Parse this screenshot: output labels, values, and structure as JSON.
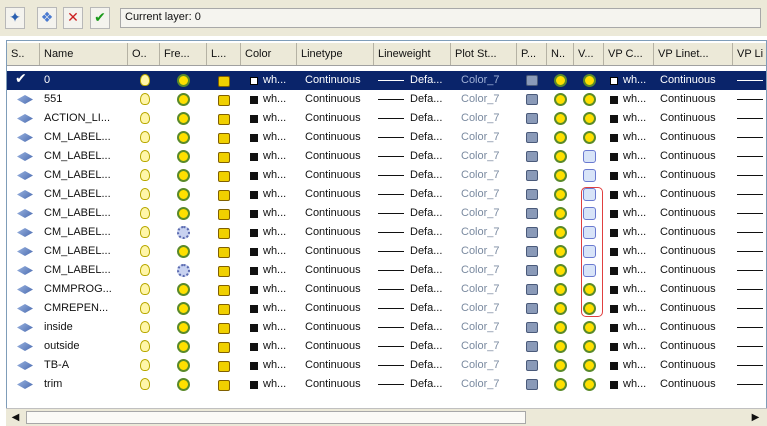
{
  "toolbar": {
    "current_layer_label": "Current layer: 0"
  },
  "headers": [
    {
      "id": "status",
      "label": "S.."
    },
    {
      "id": "name",
      "label": "Name"
    },
    {
      "id": "on",
      "label": "O.."
    },
    {
      "id": "freeze",
      "label": "Fre..."
    },
    {
      "id": "lock",
      "label": "L..."
    },
    {
      "id": "color",
      "label": "Color"
    },
    {
      "id": "linetype",
      "label": "Linetype"
    },
    {
      "id": "lineweight",
      "label": "Lineweight"
    },
    {
      "id": "plotstyle",
      "label": "Plot St..."
    },
    {
      "id": "plot",
      "label": "P..."
    },
    {
      "id": "newvp",
      "label": "N.."
    },
    {
      "id": "vpfreeze",
      "label": "V..."
    },
    {
      "id": "vpcolor",
      "label": "VP C..."
    },
    {
      "id": "vplinetype",
      "label": "VP Linet..."
    },
    {
      "id": "vplineweight",
      "label": "VP Li"
    }
  ],
  "cell_text": {
    "color": "wh...",
    "linetype": "Continuous",
    "lineweight": "Defa...",
    "plotstyle": "Color_7",
    "vpcolor": "wh...",
    "vplinetype": "Continuous"
  },
  "layers": [
    {
      "name": "0",
      "current": true,
      "selected": true,
      "freeze": "thawed",
      "vp_freeze": "thawed"
    },
    {
      "name": "551",
      "current": false,
      "selected": false,
      "freeze": "thawed",
      "vp_freeze": "thawed"
    },
    {
      "name": "ACTION_LI...",
      "current": false,
      "selected": false,
      "freeze": "thawed",
      "vp_freeze": "thawed"
    },
    {
      "name": "CM_LABEL...",
      "current": false,
      "selected": false,
      "freeze": "thawed",
      "vp_freeze": "thawed"
    },
    {
      "name": "CM_LABEL...",
      "current": false,
      "selected": false,
      "freeze": "thawed",
      "vp_freeze": "frozen"
    },
    {
      "name": "CM_LABEL...",
      "current": false,
      "selected": false,
      "freeze": "thawed",
      "vp_freeze": "frozen"
    },
    {
      "name": "CM_LABEL...",
      "current": false,
      "selected": false,
      "freeze": "thawed",
      "vp_freeze": "frozen"
    },
    {
      "name": "CM_LABEL...",
      "current": false,
      "selected": false,
      "freeze": "thawed",
      "vp_freeze": "frozen"
    },
    {
      "name": "CM_LABEL...",
      "current": false,
      "selected": false,
      "freeze": "frozen",
      "vp_freeze": "frozen"
    },
    {
      "name": "CM_LABEL...",
      "current": false,
      "selected": false,
      "freeze": "thawed",
      "vp_freeze": "frozen"
    },
    {
      "name": "CM_LABEL...",
      "current": false,
      "selected": false,
      "freeze": "frozen",
      "vp_freeze": "frozen"
    },
    {
      "name": "CMMPROG...",
      "current": false,
      "selected": false,
      "freeze": "thawed",
      "vp_freeze": "thawed"
    },
    {
      "name": "CMREPEN...",
      "current": false,
      "selected": false,
      "freeze": "thawed",
      "vp_freeze": "thawed"
    },
    {
      "name": "inside",
      "current": false,
      "selected": false,
      "freeze": "thawed",
      "vp_freeze": "thawed"
    },
    {
      "name": "outside",
      "current": false,
      "selected": false,
      "freeze": "thawed",
      "vp_freeze": "thawed"
    },
    {
      "name": "TB-A",
      "current": false,
      "selected": false,
      "freeze": "thawed",
      "vp_freeze": "thawed"
    },
    {
      "name": "trim",
      "current": false,
      "selected": false,
      "freeze": "thawed",
      "vp_freeze": "thawed"
    }
  ],
  "icons": {
    "new_layer": "new-layer-icon",
    "new_vp_frozen_layer": "new-layer-vp-frozen-icon",
    "delete_layer": "delete-icon",
    "set_current": "set-current-icon"
  },
  "colors": {
    "selection": "#0a246a",
    "highlight_box": "#e04040",
    "check": "#1a9a1a",
    "delete": "#cc2020"
  }
}
